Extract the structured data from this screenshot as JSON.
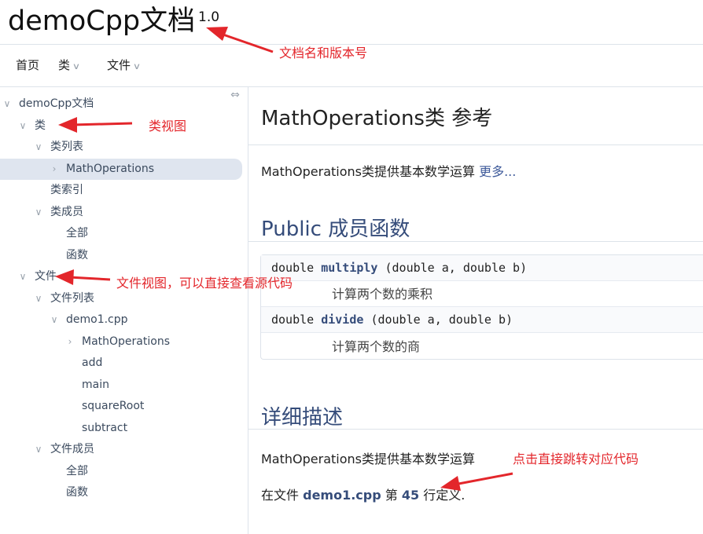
{
  "project": {
    "name": "demoCpp文档",
    "version": "1.0"
  },
  "navbar": {
    "items": [
      {
        "label": "首页",
        "chevron": false
      },
      {
        "label": "类",
        "chevron": true
      },
      {
        "label": "文件",
        "chevron": true
      }
    ]
  },
  "sidebar": {
    "sync_icon": "⇔",
    "tree": [
      {
        "label": "demoCpp文档",
        "arrow": "expanded"
      },
      {
        "label": "类",
        "arrow": "expanded"
      },
      {
        "label": "类列表",
        "arrow": "expanded"
      },
      {
        "label": "MathOperations",
        "arrow": "collapsed",
        "selected": true
      },
      {
        "label": "类索引",
        "arrow": "none"
      },
      {
        "label": "类成员",
        "arrow": "expanded"
      },
      {
        "label": "全部",
        "arrow": "none"
      },
      {
        "label": "函数",
        "arrow": "none"
      },
      {
        "label": "文件",
        "arrow": "expanded"
      },
      {
        "label": "文件列表",
        "arrow": "expanded"
      },
      {
        "label": "demo1.cpp",
        "arrow": "expanded"
      },
      {
        "label": "MathOperations",
        "arrow": "collapsed"
      },
      {
        "label": "add",
        "arrow": "none"
      },
      {
        "label": "main",
        "arrow": "none"
      },
      {
        "label": "squareRoot",
        "arrow": "none"
      },
      {
        "label": "subtract",
        "arrow": "none"
      },
      {
        "label": "文件成员",
        "arrow": "expanded"
      },
      {
        "label": "全部",
        "arrow": "none"
      },
      {
        "label": "函数",
        "arrow": "none"
      }
    ]
  },
  "content": {
    "title": "MathOperations类 参考",
    "brief_text": "MathOperations类提供基本数学运算",
    "more_link": "更多...",
    "public_header": "Public 成员函数",
    "members": [
      {
        "ret": "double",
        "name": "multiply",
        "args": "(double a, double b)",
        "desc": "计算两个数的乘积"
      },
      {
        "ret": "double",
        "name": "divide",
        "args": "(double a, double b)",
        "desc": "计算两个数的商"
      }
    ],
    "detail_header": "详细描述",
    "detail_text": "MathOperations类提供基本数学运算",
    "defined_prefix": "在文件",
    "defined_file": "demo1.cpp",
    "defined_mid": "第",
    "defined_line": "45",
    "defined_suffix": "行定义."
  },
  "annotations": {
    "doc_name": "文档名和版本号",
    "class_view": "类视图",
    "file_view": "文件视图，可以直接查看源代码",
    "jump": "点击直接跳转对应代码"
  },
  "colors": {
    "annotation": "#e3262b",
    "link": "#354c7a",
    "selected_bg": "#dfe5ef"
  }
}
